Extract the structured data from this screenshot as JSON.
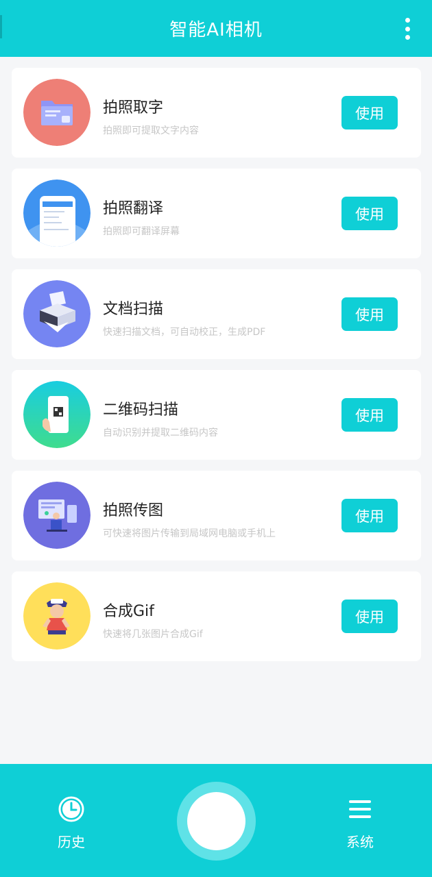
{
  "header": {
    "title": "智能AI相机"
  },
  "features": [
    {
      "name": "拍照取字",
      "desc": "拍照即可提取文字内容",
      "button": "使用",
      "icon": "folder-document-icon",
      "color": "#ee7f76"
    },
    {
      "name": "拍照翻译",
      "desc": "拍照即可翻译屏幕",
      "button": "使用",
      "icon": "phone-translate-icon",
      "color": "#3f93f0"
    },
    {
      "name": "文档扫描",
      "desc": "快速扫描文档，可自动校正，生成PDF",
      "button": "使用",
      "icon": "printer-scan-icon",
      "color": "#7585f2"
    },
    {
      "name": "二维码扫描",
      "desc": "自动识别并提取二维码内容",
      "button": "使用",
      "icon": "qr-phone-icon",
      "color": "#2fd3b0"
    },
    {
      "name": "拍照传图",
      "desc": "可快速将图片传输到局域网电脑或手机上",
      "button": "使用",
      "icon": "computer-transfer-icon",
      "color": "#6f6ee0"
    },
    {
      "name": "合成Gif",
      "desc": "快速将几张图片合成Gif",
      "button": "使用",
      "icon": "gif-character-icon",
      "color": "#ffdf5a"
    }
  ],
  "bottom_nav": {
    "history_label": "历史",
    "system_label": "系统"
  },
  "colors": {
    "accent": "#0fcfd6",
    "background": "#f5f6f8"
  }
}
